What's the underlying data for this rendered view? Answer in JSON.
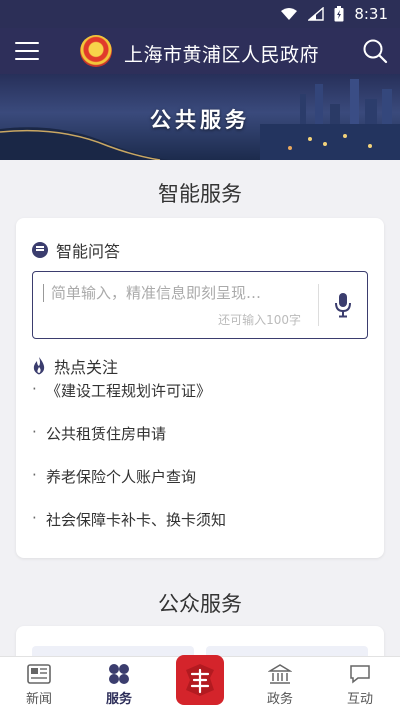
{
  "status_bar": {
    "time": "8:31"
  },
  "header": {
    "title": "上海市黄浦区人民政府",
    "icons": {
      "menu": "menu-icon",
      "emblem": "national-emblem-icon",
      "search": "search-icon"
    }
  },
  "banner": {
    "title": "公共服务"
  },
  "smart_service": {
    "section_title": "智能服务",
    "qa": {
      "label": "智能问答",
      "placeholder": "简单输入，精准信息即刻呈现…",
      "counter": "还可输入100字"
    },
    "hot": {
      "label": "热点关注",
      "items": [
        "《建设工程规划许可证》",
        "公共租赁住房申请",
        "养老保险个人账户查询",
        "社会保障卡补卡、换卡须知"
      ]
    }
  },
  "public_service": {
    "section_title": "公众服务"
  },
  "bottom_nav": {
    "items": [
      {
        "label": "新闻",
        "icon": "newspaper-icon"
      },
      {
        "label": "服务",
        "icon": "grid-icon",
        "active": true
      },
      {
        "label": "政务",
        "icon": "building-icon"
      },
      {
        "label": "互动",
        "icon": "chat-icon"
      }
    ]
  },
  "colors": {
    "primary": "#2e2f5a",
    "accent": "#3b3d6e",
    "background": "#f1f1f4"
  }
}
